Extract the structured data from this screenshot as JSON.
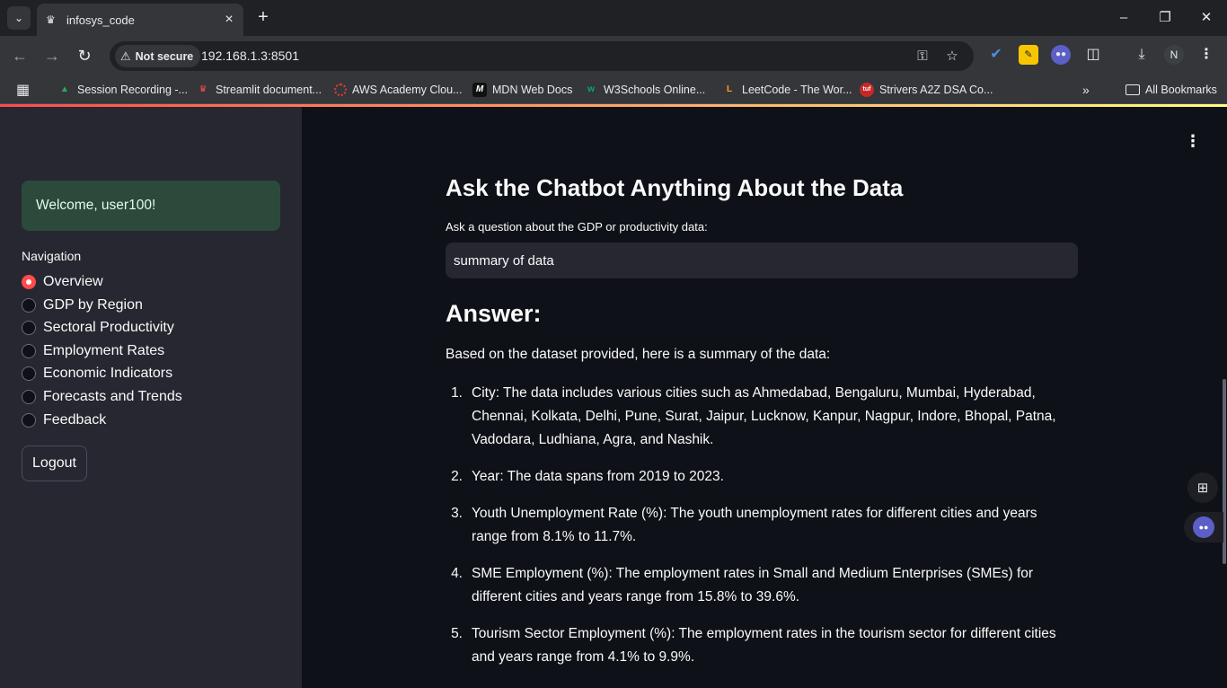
{
  "browser": {
    "tab_title": "infosys_code",
    "security_label": "Not secure",
    "url": "192.168.1.3:8501",
    "profile_initial": "N",
    "bookmarks": [
      {
        "label": "Session Recording -...",
        "icon": "drive-icon"
      },
      {
        "label": "Streamlit document...",
        "icon": "streamlit-icon"
      },
      {
        "label": "AWS Academy Clou...",
        "icon": "aws-icon"
      },
      {
        "label": "MDN Web Docs",
        "icon": "mdn-icon"
      },
      {
        "label": "W3Schools Online...",
        "icon": "w3schools-icon"
      },
      {
        "label": "LeetCode - The Wor...",
        "icon": "leetcode-icon"
      },
      {
        "label": "Strivers A2Z DSA Co...",
        "icon": "tuf-icon"
      }
    ],
    "all_bookmarks_label": "All Bookmarks",
    "accent_line_colors": [
      "#ff4b4b",
      "#fffd80"
    ]
  },
  "sidebar": {
    "welcome": "Welcome, user100!",
    "nav_label": "Navigation",
    "nav_items": [
      {
        "label": "Overview",
        "selected": true
      },
      {
        "label": "GDP by Region",
        "selected": false
      },
      {
        "label": "Sectoral Productivity",
        "selected": false
      },
      {
        "label": "Employment Rates",
        "selected": false
      },
      {
        "label": "Economic Indicators",
        "selected": false
      },
      {
        "label": "Forecasts and Trends",
        "selected": false
      },
      {
        "label": "Feedback",
        "selected": false
      }
    ],
    "logout_label": "Logout"
  },
  "main": {
    "heading": "Ask the Chatbot Anything About the Data",
    "question_label": "Ask a question about the GDP or productivity data:",
    "question_value": "summary of data",
    "answer_heading": "Answer:",
    "answer_intro": "Based on the dataset provided, here is a summary of the data:",
    "answer_items": [
      {
        "num": "1.",
        "text": "City: The data includes various cities such as Ahmedabad, Bengaluru, Mumbai, Hyderabad, Chennai, Kolkata, Delhi, Pune, Surat, Jaipur, Lucknow, Kanpur, Nagpur, Indore, Bhopal, Patna, Vadodara, Ludhiana, Agra, and Nashik."
      },
      {
        "num": "2.",
        "text": "Year: The data spans from 2019 to 2023."
      },
      {
        "num": "3.",
        "text": "Youth Unemployment Rate (%): The youth unemployment rates for different cities and years range from 8.1% to 11.7%."
      },
      {
        "num": "4.",
        "text": "SME Employment (%): The employment rates in Small and Medium Enterprises (SMEs) for different cities and years range from 15.8% to 39.6%."
      },
      {
        "num": "5.",
        "text": "Tourism Sector Employment (%): The employment rates in the tourism sector for different cities and years range from 4.1% to 9.9%."
      }
    ]
  },
  "colors": {
    "primary": "#ff4b4b",
    "sidebar_bg": "#262730",
    "main_bg": "#0e1117",
    "success_bg": "#2b4a3b",
    "success_text": "#dffde9"
  }
}
